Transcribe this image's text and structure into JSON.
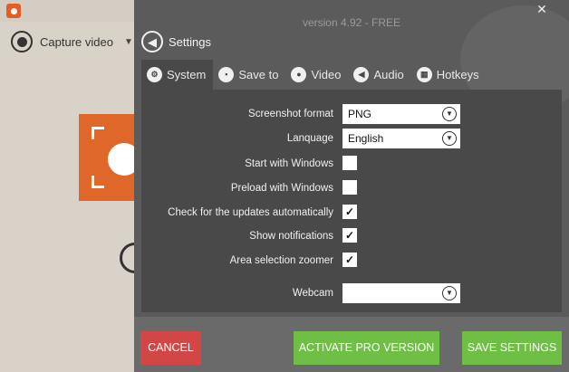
{
  "app": {
    "capture_label": "Capture video"
  },
  "overlay": {
    "version": "version 4.92 - FREE",
    "header_title": "Settings"
  },
  "tabs": [
    {
      "label": "System",
      "icon": "system-icon",
      "active": true
    },
    {
      "label": "Save to",
      "icon": "save-icon",
      "active": false
    },
    {
      "label": "Video",
      "icon": "video-icon",
      "active": false
    },
    {
      "label": "Audio",
      "icon": "audio-icon",
      "active": false
    },
    {
      "label": "Hotkeys",
      "icon": "hotkeys-icon",
      "active": false
    }
  ],
  "settings": {
    "screenshot_format": {
      "label": "Screenshot format",
      "value": "PNG"
    },
    "language": {
      "label": "Lanquage",
      "value": "English"
    },
    "start_with_windows": {
      "label": "Start with Windows",
      "checked": false
    },
    "preload_with_windows": {
      "label": "Preload with Windows",
      "checked": false
    },
    "check_updates": {
      "label": "Check for the updates automatically",
      "checked": true
    },
    "show_notifications": {
      "label": "Show notifications",
      "checked": true
    },
    "area_zoomer": {
      "label": "Area selection zoomer",
      "checked": true
    },
    "webcam": {
      "label": "Webcam",
      "value": ""
    }
  },
  "footer": {
    "cancel_label": "CANCEL",
    "activate_label": "ACTIVATE PRO VERSION",
    "save_label": "SAVE SETTINGS"
  },
  "colors": {
    "overlay_bg": "#5b5b5b",
    "panel_bg": "#494949",
    "cancel": "#d24645",
    "accept": "#6fbf46",
    "brand": "#e35d27"
  }
}
